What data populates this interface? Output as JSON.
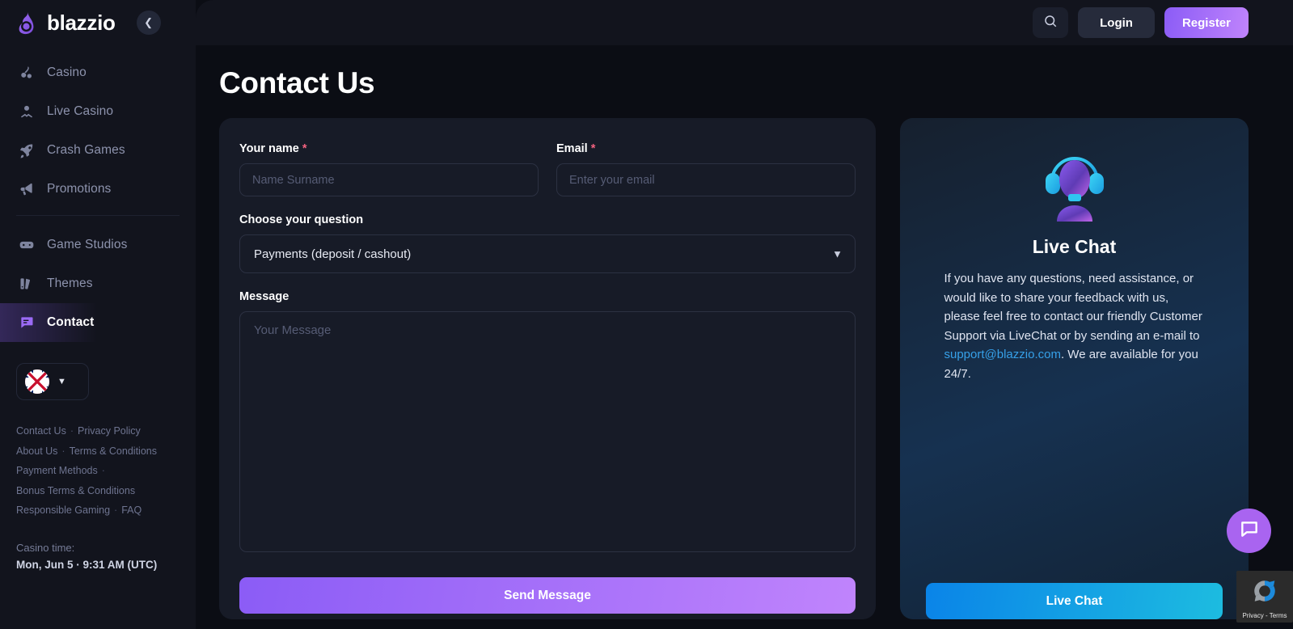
{
  "brand": {
    "name": "blazzio",
    "logo_icon": "flame-logo-icon"
  },
  "sidebar": {
    "collapse_icon": "chevron-left-icon",
    "nav_primary": [
      {
        "label": "Casino",
        "icon": "cherry-icon"
      },
      {
        "label": "Live Casino",
        "icon": "bowtie-dealer-icon"
      },
      {
        "label": "Crash Games",
        "icon": "rocket-icon"
      },
      {
        "label": "Promotions",
        "icon": "megaphone-icon"
      }
    ],
    "nav_secondary": [
      {
        "label": "Game Studios",
        "icon": "gamepad-icon"
      },
      {
        "label": "Themes",
        "icon": "books-icon"
      },
      {
        "label": "Contact",
        "icon": "chat-bubble-icon",
        "active": true
      }
    ],
    "language": {
      "flag": "uk-flag-icon",
      "caret": "chevron-down-icon"
    },
    "footer_links": [
      "Contact Us",
      "Privacy Policy",
      "About Us",
      "Terms & Conditions",
      "Payment Methods",
      "Bonus Terms & Conditions",
      "Responsible Gaming",
      "FAQ"
    ],
    "casino_time": {
      "label": "Casino time:",
      "value": "Mon, Jun 5 · 9:31 AM (UTC)"
    }
  },
  "topbar": {
    "search_icon": "search-icon",
    "login_label": "Login",
    "register_label": "Register"
  },
  "page": {
    "title": "Contact Us"
  },
  "form": {
    "name": {
      "label": "Your name",
      "required_mark": "*",
      "placeholder": "Name Surname",
      "value": ""
    },
    "email": {
      "label": "Email",
      "required_mark": "*",
      "placeholder": "Enter your email",
      "value": ""
    },
    "question": {
      "label": "Choose your question",
      "selected": "Payments (deposit / cashout)",
      "caret_icon": "chevron-down-icon"
    },
    "message": {
      "label": "Message",
      "placeholder": "Your Message",
      "value": ""
    },
    "submit_label": "Send Message"
  },
  "live_chat": {
    "icon": "headset-support-icon",
    "title": "Live Chat",
    "body_part1": "If you have any questions, need assistance, or would like to share your feedback with us, please feel free to contact our friendly Customer Support via LiveChat or by sending an e-mail to ",
    "email_link": "support@blazzio.com",
    "body_part2": ". We are available for you 24/7.",
    "button_label": "Live Chat"
  },
  "widgets": {
    "chat_fab_icon": "chat-bubble-icon",
    "recaptcha": {
      "icon": "recaptcha-icon",
      "label": "Privacy - Terms"
    }
  },
  "colors": {
    "page_bg": "#0b0d14",
    "sidebar_bg": "#12141d",
    "card_bg": "#171b27",
    "accent_purple": "#8b5cf6",
    "accent_purple_light": "#c084fc",
    "accent_blue": "#0a84e8",
    "accent_cyan": "#1dbce0",
    "link_blue": "#36a0e8",
    "required_red": "#f2627f",
    "muted_text": "#8d93ad"
  }
}
